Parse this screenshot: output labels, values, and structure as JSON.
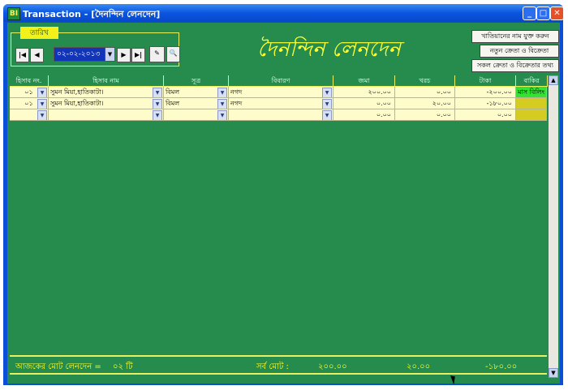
{
  "window": {
    "app_icon": "BI",
    "title": "Transaction  -  [দৈনন্দিন লেনদেন]",
    "controls": [
      "_",
      "□",
      "✕"
    ]
  },
  "date_panel": {
    "label": "তারিখ",
    "date_value": "০২-০২-২০১৩",
    "buttons": [
      "first",
      "prev",
      "next",
      "last",
      "edit",
      "preview"
    ]
  },
  "main_title": "দৈনন্দিন লেনদেন",
  "right_buttons": [
    "খাতিয়ানের নাম যুক্ত করুন",
    "নতুন ক্রেতা ও বিক্রেতা",
    "সকল ক্রেতা ও বিক্রেতার তথ্য"
  ],
  "grid": {
    "columns": [
      "হিসাব নং.",
      "হিসাব নাম",
      "সূত্র",
      "বিবারণ",
      "জমা",
      "খরচ",
      "টাকা",
      "বাকির"
    ],
    "rows": [
      {
        "no": "০১",
        "name": "সুমন মিয়া,হাতিকাটা।",
        "source": "বিমল",
        "desc": "নগদ",
        "deposit": "২০০.০০",
        "expense": "০.০০",
        "amount": "-২০০.০০",
        "due": "মাস বিলিং"
      },
      {
        "no": "০১",
        "name": "সুমন মিয়া,হাতিকাটা।",
        "source": "বিমল",
        "desc": "নগদ",
        "deposit": "০.০০",
        "expense": "২০.০০",
        "amount": "-১৮০.০০",
        "due": ""
      },
      {
        "no": "",
        "name": "",
        "source": "",
        "desc": "",
        "deposit": "০.০০",
        "expense": "০.০০",
        "amount": "০.০০",
        "due": ""
      }
    ]
  },
  "footer": {
    "today_label": "আজকের মোট লেনদেন  =",
    "today_count": "০২  টি",
    "total_label": "সর্ব মোট :",
    "total_deposit": "২০০.০০",
    "total_expense": "২০.০০",
    "total_amount": "-১৮০.০০"
  },
  "colors": {
    "background": "#268c4e",
    "accent_yellow": "#ffff33",
    "cell_bg": "#fffccb",
    "titlebar": "#0a55e0"
  }
}
